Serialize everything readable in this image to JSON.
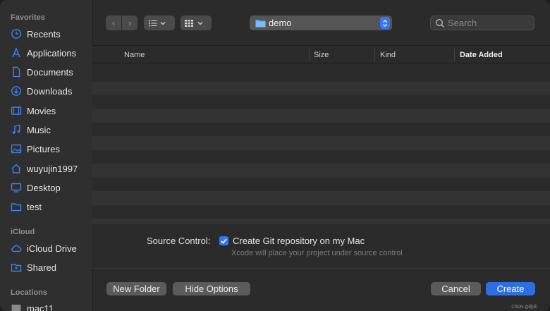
{
  "sidebar": {
    "favorites_title": "Favorites",
    "items": [
      {
        "label": "Recents",
        "icon": "clock-icon"
      },
      {
        "label": "Applications",
        "icon": "applications-icon"
      },
      {
        "label": "Documents",
        "icon": "document-icon"
      },
      {
        "label": "Downloads",
        "icon": "download-icon"
      },
      {
        "label": "Movies",
        "icon": "film-icon"
      },
      {
        "label": "Music",
        "icon": "music-note-icon"
      },
      {
        "label": "Pictures",
        "icon": "photo-icon"
      },
      {
        "label": "wuyujin1997",
        "icon": "home-icon"
      },
      {
        "label": "Desktop",
        "icon": "desktop-icon"
      },
      {
        "label": "test",
        "icon": "folder-icon"
      }
    ],
    "icloud_title": "iCloud",
    "icloud_items": [
      {
        "label": "iCloud Drive",
        "icon": "cloud-icon"
      },
      {
        "label": "Shared",
        "icon": "shared-folder-icon"
      }
    ],
    "locations_title": "Locations",
    "location_items": [
      {
        "label": "mac11",
        "icon": "computer-icon"
      }
    ]
  },
  "toolbar": {
    "back_glyph": "‹",
    "forward_glyph": "›",
    "folder_name": "demo",
    "search_placeholder": "Search"
  },
  "table": {
    "columns": [
      "Name",
      "Size",
      "Kind",
      "Date Added"
    ],
    "sorted_column": "Date Added",
    "rows": []
  },
  "options": {
    "source_control_label": "Source Control:",
    "create_git_label": "Create Git repository on my Mac",
    "create_git_checked": true,
    "hint": "Xcode will place your project under source control"
  },
  "buttons": {
    "new_folder": "New Folder",
    "hide_options": "Hide Options",
    "cancel": "Cancel",
    "create": "Create"
  },
  "watermark": "CSDN @链夫",
  "colors": {
    "accent": "#2d6fe3",
    "checkbox": "#3477f5",
    "sidebar_icon": "#3b82f6"
  }
}
